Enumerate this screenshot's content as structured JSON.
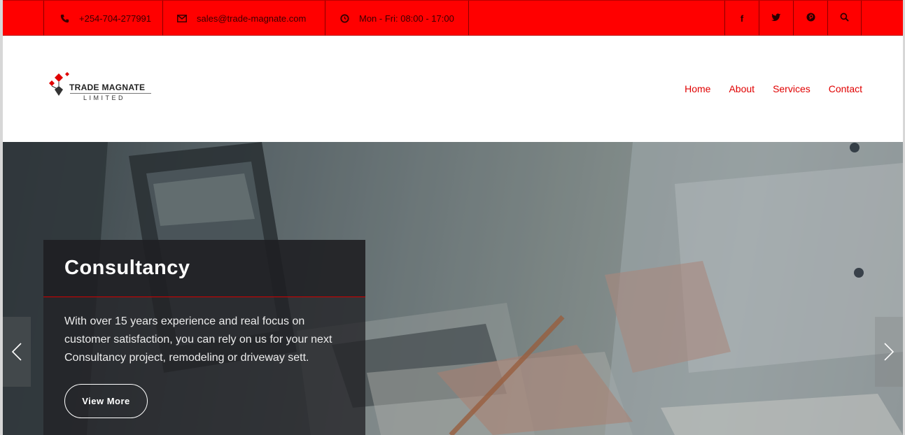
{
  "topbar": {
    "phone": "+254-704-277991",
    "email": "sales@trade-magnate.com",
    "hours": "Mon - Fri: 08:00 - 17:00",
    "social": [
      {
        "name": "facebook-icon",
        "glyph": "f"
      },
      {
        "name": "twitter-icon",
        "glyph": "twitter"
      },
      {
        "name": "pinterest-icon",
        "glyph": "pinterest"
      },
      {
        "name": "search-icon",
        "glyph": "search"
      }
    ]
  },
  "brand": {
    "name": "TRADE MAGNATE",
    "sub": "LIMITED"
  },
  "nav": {
    "items": [
      "Home",
      "About",
      "Services",
      "Contact"
    ]
  },
  "hero": {
    "title": "Consultancy",
    "text": "With over 15 years experience and real focus on customer satisfaction, you can rely on us for your next Consultancy project, remodeling or driveway sett.",
    "button": "View More"
  },
  "colors": {
    "accent": "#ff0000",
    "nav_text": "#e00000"
  }
}
